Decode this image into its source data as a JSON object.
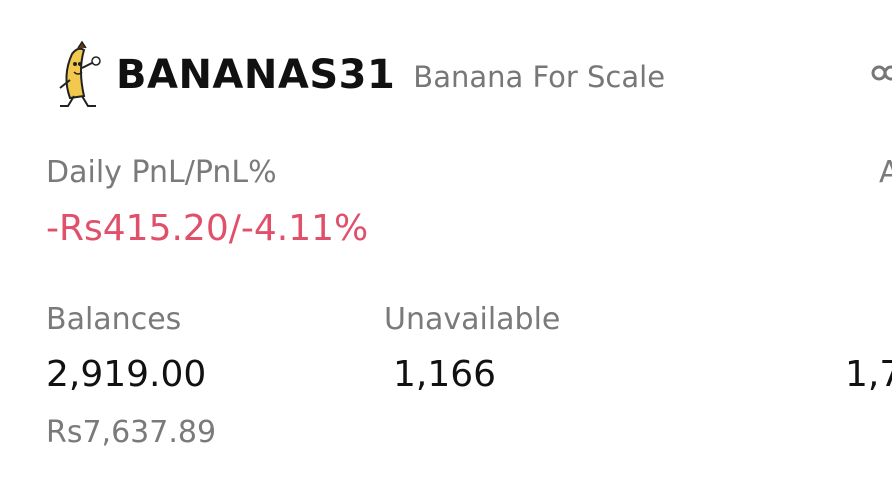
{
  "token": {
    "symbol": "BANANAS31",
    "name": "Banana For Scale",
    "logo_icon": "banana-mascot-icon"
  },
  "pnl": {
    "label": "Daily PnL/PnL%",
    "value": "-Rs415.20/-4.11%",
    "color": "#e0506b"
  },
  "balances": {
    "label": "Balances",
    "value": "2,919.00",
    "fiat_value": "Rs7,637.89"
  },
  "unavailable": {
    "label": "Unavailable",
    "value": "1,166"
  },
  "cropped_right": {
    "label_partial": "A",
    "value_partial": "1,7",
    "icon": "link-icon"
  }
}
